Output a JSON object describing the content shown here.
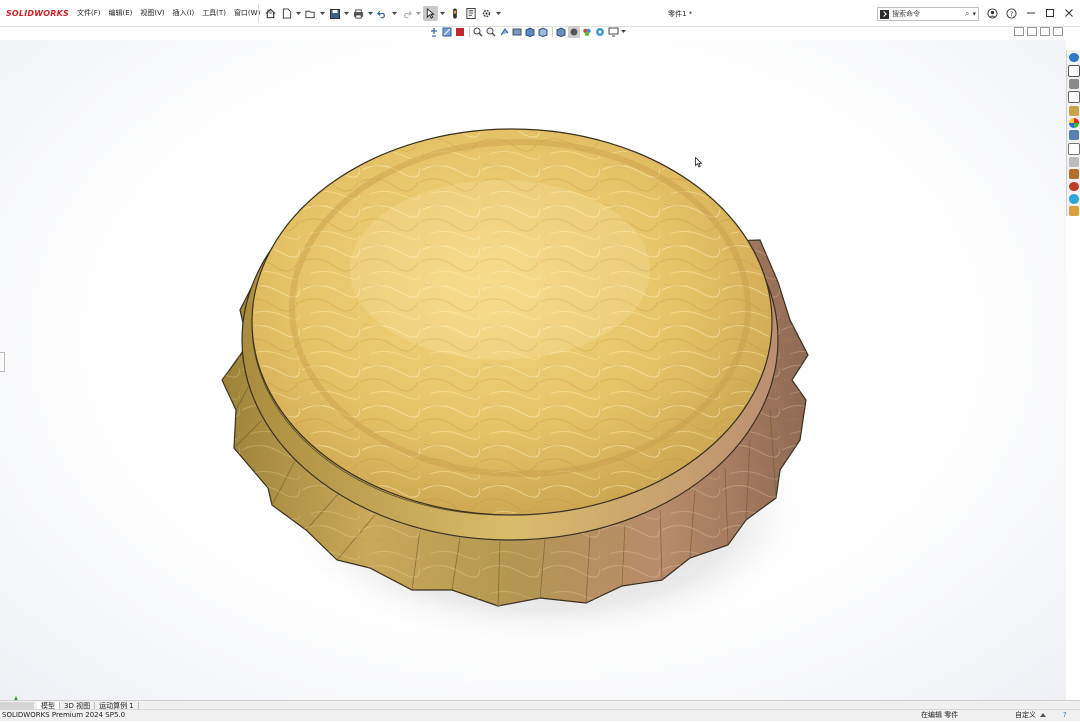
{
  "app": {
    "logo_text": "SOLIDWORKS",
    "brand_color": "#d11f26"
  },
  "menu": [
    {
      "label": "文件(F)"
    },
    {
      "label": "编辑(E)"
    },
    {
      "label": "视图(V)"
    },
    {
      "label": "插入(I)"
    },
    {
      "label": "工具(T)"
    },
    {
      "label": "窗口(W)"
    }
  ],
  "quick_access": [
    "home-icon",
    "new-document-icon",
    "open-icon",
    "save-icon",
    "print-icon",
    "undo-icon",
    "redo-icon",
    "select-icon",
    "rebuild-icon",
    "file-properties-icon",
    "options-icon"
  ],
  "document": {
    "title": "零件1 *"
  },
  "search": {
    "placeholder": "搜索命令"
  },
  "view_toolbar": [
    "zoom-to-fit-icon",
    "zoom-to-area-icon",
    "previous-view-icon",
    "section-view-icon",
    "dynamic-annotation-icon",
    "view-orientation-icon",
    "display-style-icon",
    "hide-show-items-icon",
    "edit-appearance-icon",
    "apply-scene-icon",
    "view-settings-icon"
  ],
  "task_pane": [
    "solidworks-resources-icon",
    "design-library-icon",
    "file-explorer-icon",
    "view-palette-icon",
    "appearances-icon",
    "custom-properties-icon",
    "solidworks-forum-icon",
    "3dexperience-icon",
    "toolbox-icon",
    "materials-icon",
    "appearances-scenes-icon",
    "cloud-icon"
  ],
  "bottom_tabs": [
    {
      "label": "模型",
      "active": true
    },
    {
      "label": "3D 视图",
      "active": false
    },
    {
      "label": "运动算例 1",
      "active": false
    }
  ],
  "status_bar": {
    "version": "SOLIDWORKS Premium 2024 SP5.0",
    "mode": "在编辑 零件",
    "units": "自定义"
  },
  "model": {
    "name": "bottle-cap",
    "material_color": "#d8b25a",
    "shadow_color": "#cfcfcf"
  }
}
